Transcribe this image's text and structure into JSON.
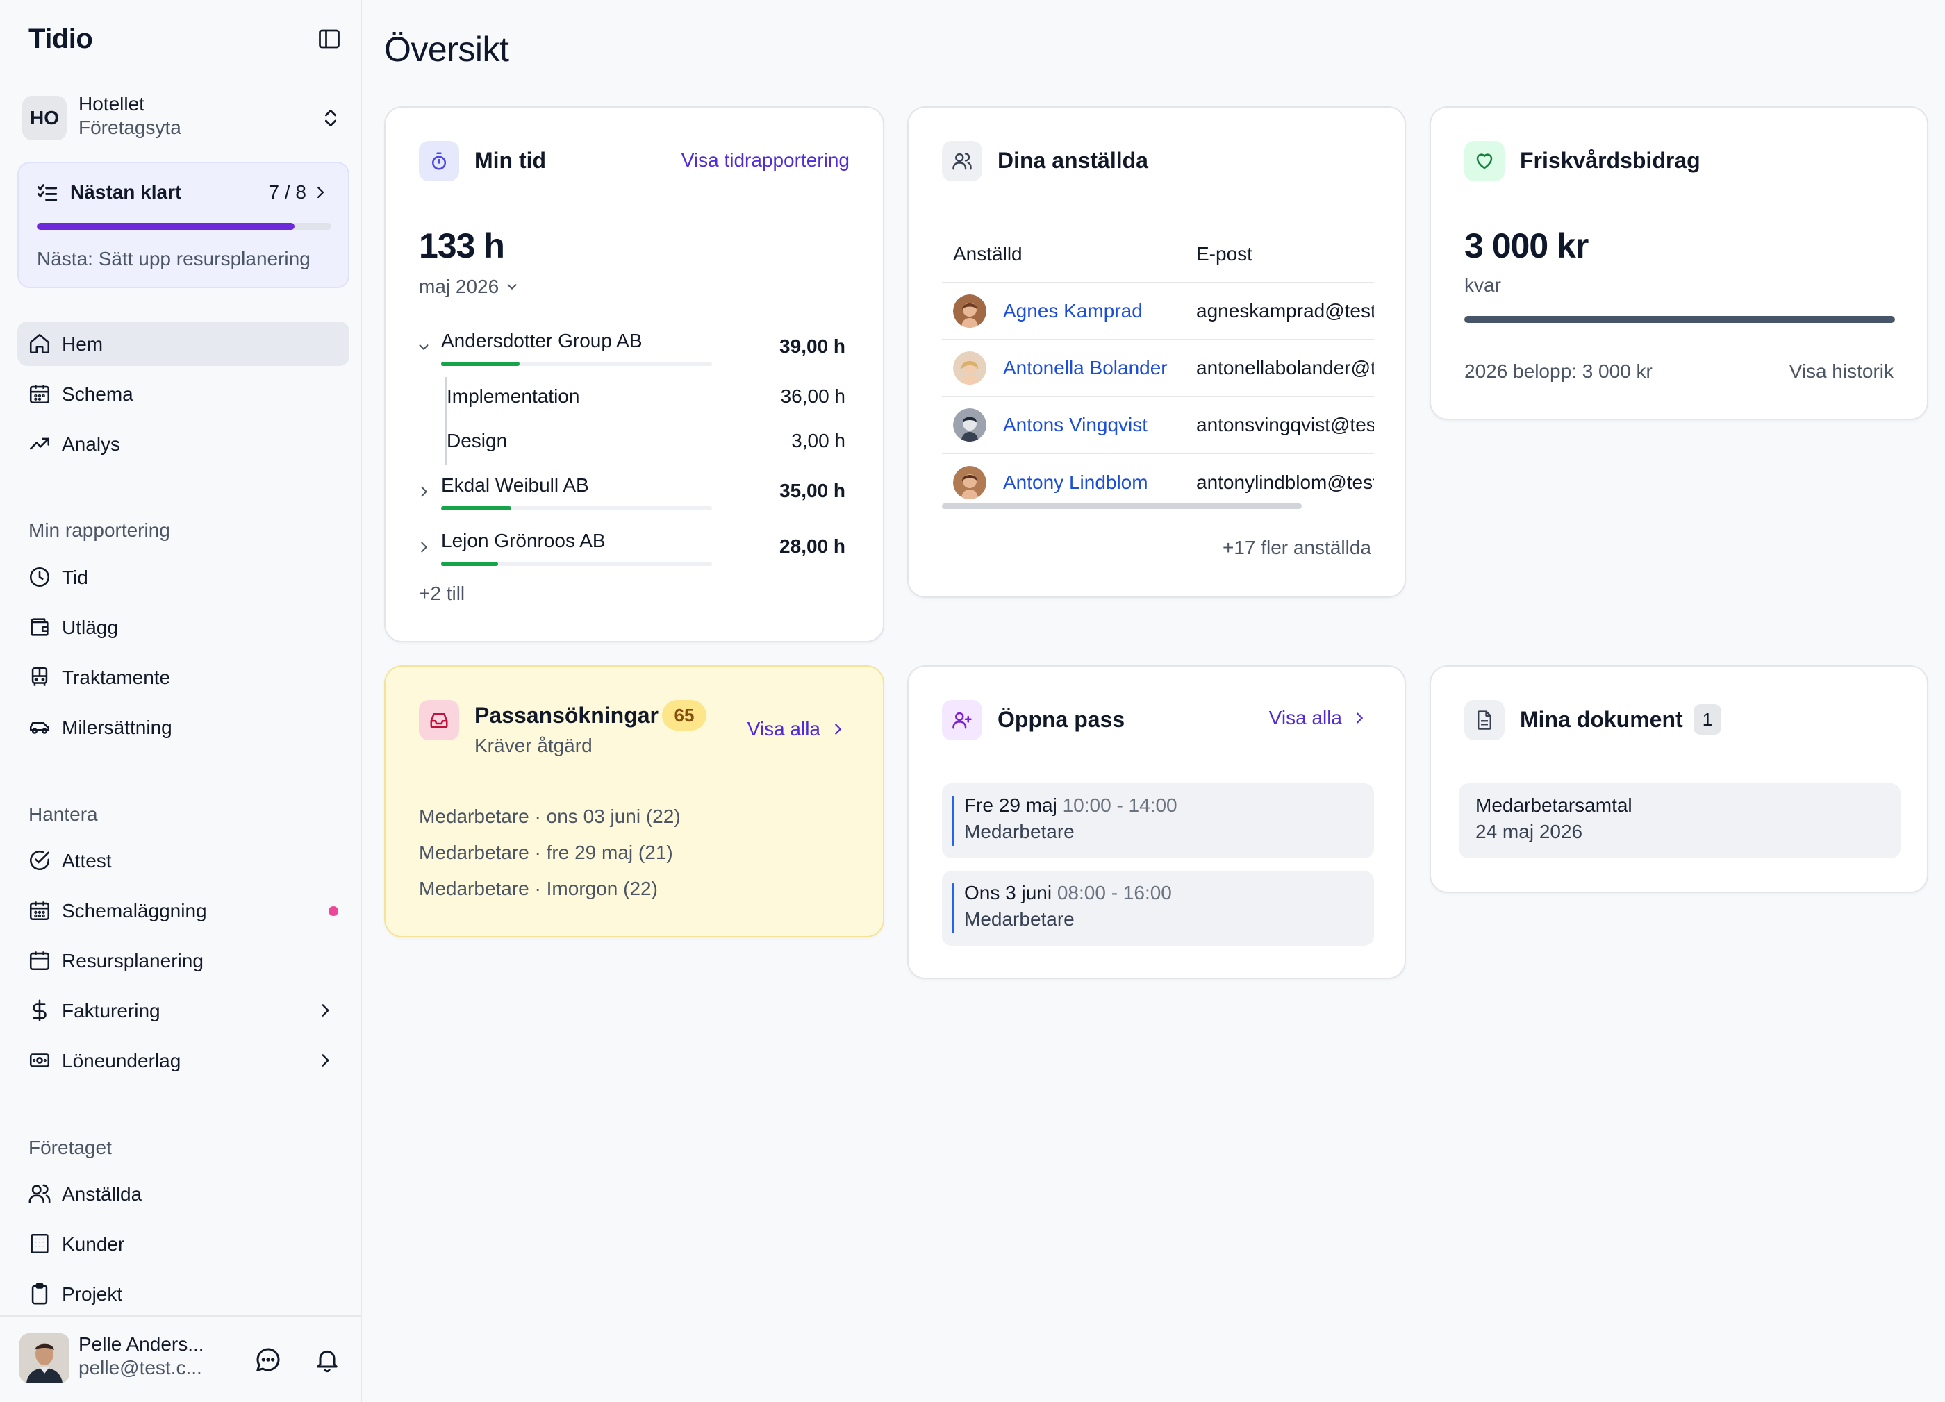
{
  "app": {
    "logo": "Tidio",
    "page_title": "Översikt"
  },
  "org": {
    "initials": "HO",
    "name": "Hotellet",
    "subtitle": "Företagsyta"
  },
  "onboarding": {
    "title": "Nästan klart",
    "count": "7 / 8",
    "progress": 0.875,
    "next": "Nästa: Sätt upp resursplanering"
  },
  "nav": {
    "main": [
      {
        "label": "Hem",
        "icon": "home-icon",
        "active": true
      },
      {
        "label": "Schema",
        "icon": "calendar-icon"
      },
      {
        "label": "Analys",
        "icon": "trending-up-icon"
      }
    ],
    "reporting_title": "Min rapportering",
    "reporting": [
      {
        "label": "Tid",
        "icon": "clock-icon"
      },
      {
        "label": "Utlägg",
        "icon": "wallet-icon"
      },
      {
        "label": "Traktamente",
        "icon": "bus-icon"
      },
      {
        "label": "Milersättning",
        "icon": "car-icon"
      }
    ],
    "manage_title": "Hantera",
    "manage": [
      {
        "label": "Attest",
        "icon": "check-circle-icon"
      },
      {
        "label": "Schemaläggning",
        "icon": "calendar-grid-icon",
        "dot": true
      },
      {
        "label": "Resursplanering",
        "icon": "calendar-icon"
      },
      {
        "label": "Fakturering",
        "icon": "dollar-icon",
        "chevron": true
      },
      {
        "label": "Löneunderlag",
        "icon": "banknote-icon",
        "chevron": true
      }
    ],
    "company_title": "Företaget",
    "company": [
      {
        "label": "Anställda",
        "icon": "users-icon"
      },
      {
        "label": "Kunder",
        "icon": "building-icon"
      },
      {
        "label": "Projekt",
        "icon": "clipboard-icon"
      }
    ]
  },
  "user": {
    "name": "Pelle Anders...",
    "email": "pelle@test.c..."
  },
  "min_tid": {
    "title": "Min tid",
    "link": "Visa tidrapportering",
    "total": "133 h",
    "period": "maj 2026",
    "projects": [
      {
        "name": "Andersdotter Group AB",
        "hours": "39,00 h",
        "share": 0.29,
        "expanded": true,
        "children": [
          {
            "name": "Implementation",
            "hours": "36,00 h"
          },
          {
            "name": "Design",
            "hours": "3,00 h"
          }
        ]
      },
      {
        "name": "Ekdal Weibull AB",
        "hours": "35,00 h",
        "share": 0.26
      },
      {
        "name": "Lejon Grönroos AB",
        "hours": "28,00 h",
        "share": 0.21
      }
    ],
    "more": "+2 till"
  },
  "employees": {
    "title": "Dina anställda",
    "columns": [
      "Anställd",
      "E-post"
    ],
    "rows": [
      {
        "name": "Agnes Kamprad",
        "email": "agneskamprad@test.se"
      },
      {
        "name": "Antonella Bolander",
        "email": "antonellabolander@test.se"
      },
      {
        "name": "Antons Vingqvist",
        "email": "antonsvingqvist@test.se"
      },
      {
        "name": "Antony Lindblom",
        "email": "antonylindblom@test.se"
      }
    ],
    "more": "+17 fler anställda"
  },
  "wellness": {
    "title": "Friskvårdsbidrag",
    "amount": "3 000 kr",
    "remaining_label": "kvar",
    "remaining_share": 1.0,
    "year_amount": "2026 belopp: 3 000 kr",
    "history_link": "Visa historik"
  },
  "applications": {
    "title": "Passansökningar",
    "count": "65",
    "subtitle": "Kräver åtgärd",
    "link": "Visa alla",
    "items": [
      "Medarbetare · ons 03 juni (22)",
      "Medarbetare · fre 29 maj (21)",
      "Medarbetare · Imorgon (22)"
    ]
  },
  "open_shifts": {
    "title": "Öppna pass",
    "link": "Visa alla",
    "items": [
      {
        "date": "Fre 29 maj",
        "time": "10:00 - 14:00",
        "role": "Medarbetare"
      },
      {
        "date": "Ons 3 juni",
        "time": "08:00 - 16:00",
        "role": "Medarbetare"
      }
    ]
  },
  "documents": {
    "title": "Mina dokument",
    "count": "1",
    "items": [
      {
        "name": "Medarbetarsamtal",
        "date": "24 maj 2026"
      }
    ]
  },
  "colors": {
    "accent": "#6d28d9",
    "link": "#4f2bd9",
    "employee_link": "#1d4ed8",
    "success": "#16a34a",
    "warning_bg": "#fef9db",
    "dot": "#ec4899"
  }
}
